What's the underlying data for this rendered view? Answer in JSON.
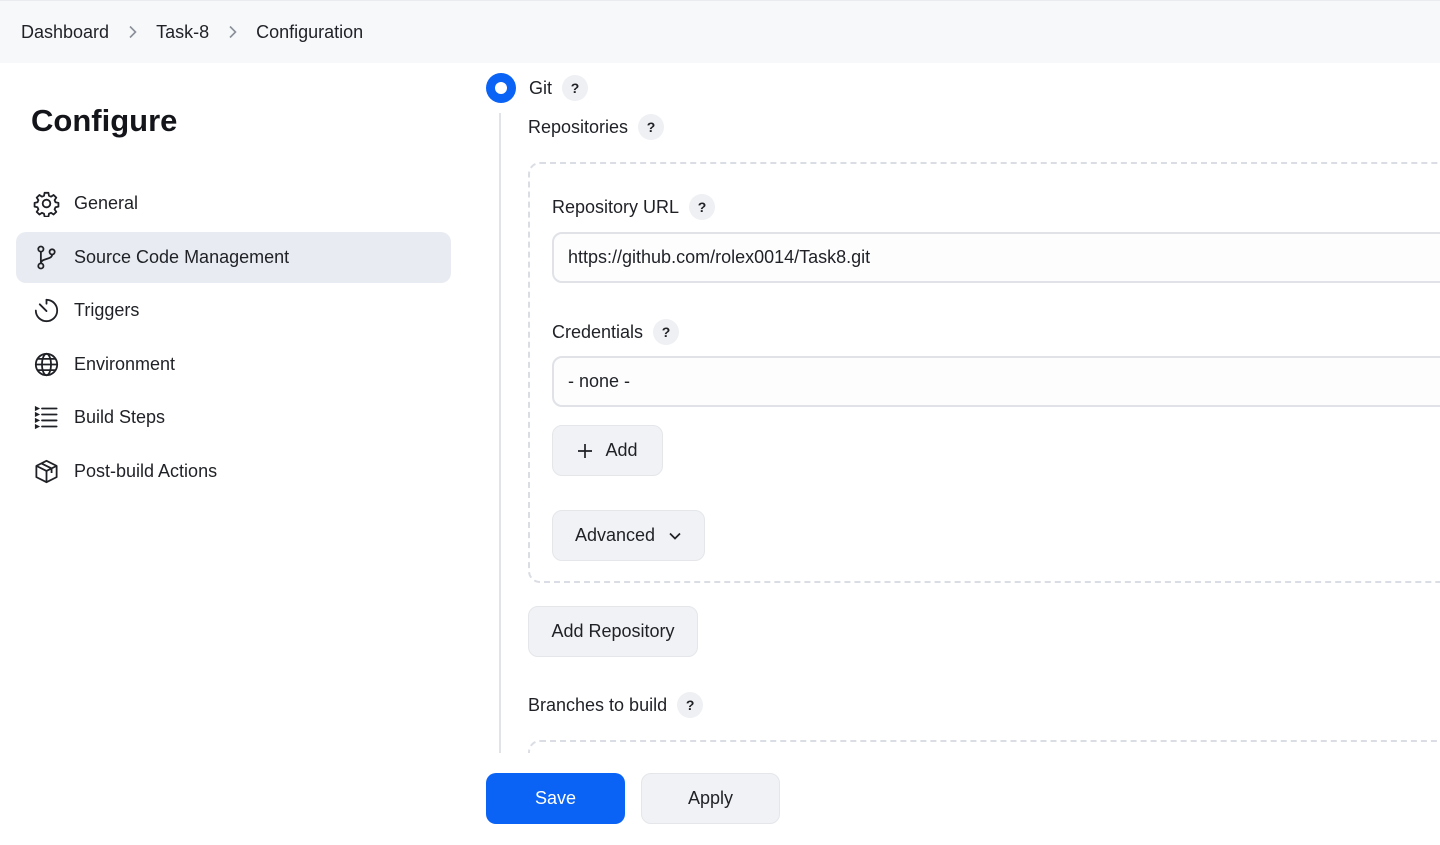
{
  "breadcrumb": {
    "items": [
      "Dashboard",
      "Task-8",
      "Configuration"
    ]
  },
  "sidebar": {
    "title": "Configure",
    "items": [
      {
        "label": "General",
        "icon": "gear-icon"
      },
      {
        "label": "Source Code Management",
        "icon": "branch-icon",
        "active": true
      },
      {
        "label": "Triggers",
        "icon": "timer-icon"
      },
      {
        "label": "Environment",
        "icon": "globe-icon"
      },
      {
        "label": "Build Steps",
        "icon": "list-icon"
      },
      {
        "label": "Post-build Actions",
        "icon": "package-icon"
      }
    ]
  },
  "scm": {
    "option_label": "Git",
    "help_symbol": "?",
    "repositories_label": "Repositories",
    "repository_url_label": "Repository URL",
    "repository_url_value": "https://github.com/rolex0014/Task8.git",
    "credentials_label": "Credentials",
    "credentials_value": "- none -",
    "add_button": "Add",
    "advanced_button": "Advanced",
    "add_repository_button": "Add Repository",
    "branches_label": "Branches to build"
  },
  "footer": {
    "save_label": "Save",
    "apply_label": "Apply"
  },
  "colors": {
    "accent": "#0b63f6",
    "sidebar_active": "#e8ebf1",
    "breadcrumb_bg": "#f7f8fa"
  }
}
